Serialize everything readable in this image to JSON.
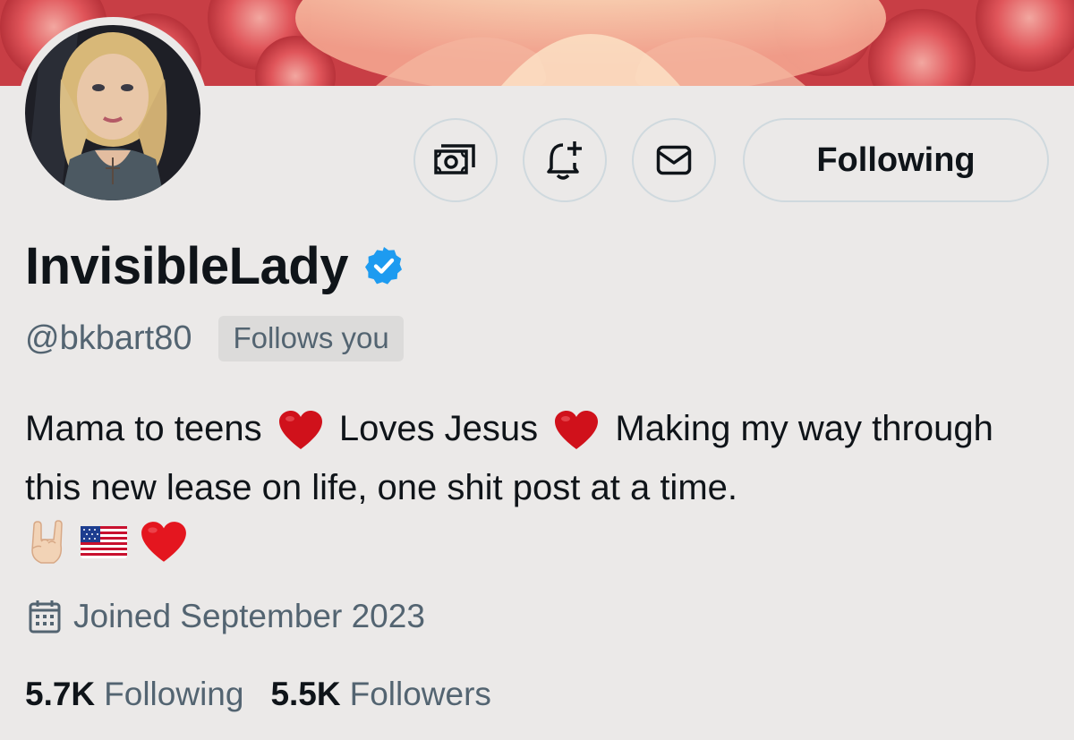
{
  "profile": {
    "display_name": "InvisibleLady",
    "handle": "@bkbart80",
    "follows_you_badge": "Follows you",
    "verified": true,
    "bio": {
      "part1": "Mama to teens",
      "part2": "Loves Jesus",
      "part3": "Making my way through this new lease on life, one shit post at a time."
    },
    "bio_emojis": [
      "red-heart",
      "red-heart",
      "sign-of-horns",
      "us-flag",
      "red-heart"
    ],
    "joined": "Joined September 2023"
  },
  "actions": {
    "subscribe_icon": "money-icon",
    "notify_icon": "bell-plus-icon",
    "message_icon": "mail-icon",
    "follow_label": "Following"
  },
  "stats": {
    "following_count": "5.7K",
    "following_label": "Following",
    "followers_count": "5.5K",
    "followers_label": "Followers"
  },
  "colors": {
    "background": "#ebe9e8",
    "text_primary": "#0f1419",
    "text_secondary": "#536471",
    "verified_blue": "#1d9bf0",
    "border": "#cfd9de",
    "heart_red": "#d0111b"
  }
}
